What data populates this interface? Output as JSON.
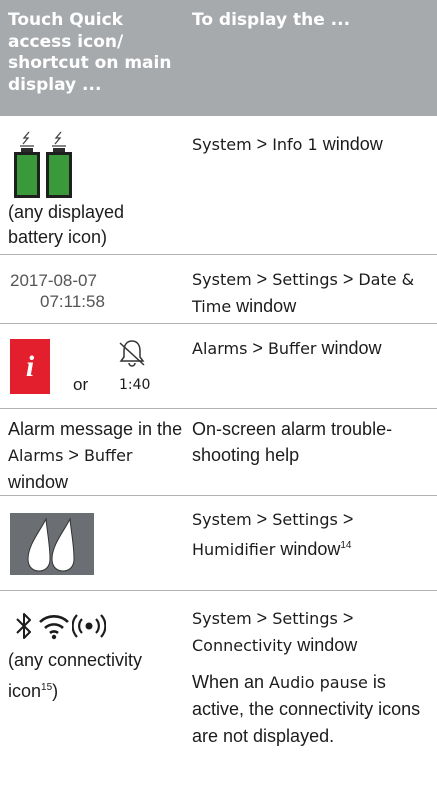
{
  "header": {
    "col1": "Touch Quick access icon/ shortcut on main display ...",
    "col2": "To display the ..."
  },
  "rows": [
    {
      "left_caption": "(any displayed battery icon)",
      "right": {
        "p1": "System",
        "sep1": " > ",
        "p2": "Info 1",
        "p3": " window"
      }
    },
    {
      "date": "2017-08-07",
      "time": "07:11:58",
      "right": {
        "p1": "System",
        "sep1": " > ",
        "p2": "Settings",
        "sep2": " > ",
        "p3": "Date & Time",
        "p4": " window"
      }
    },
    {
      "or": "or",
      "timer": "1:40",
      "right": {
        "p1": "Alarms",
        "sep1": " > ",
        "p2": "Buffer",
        "p3": " window"
      }
    },
    {
      "left": {
        "t1": "Alarm message in the ",
        "t2": "Alarms",
        "t3": " > ",
        "t4": "Buffer",
        "t5": " window"
      },
      "right": "On-screen alarm trouble-shooting help"
    },
    {
      "right": {
        "p1": "System",
        "sep1": " > ",
        "p2": "Settings",
        "sep2": " > ",
        "p3": "Humidifier",
        "p4": " window",
        "sup": "14"
      }
    },
    {
      "left_caption": "(any connectivity icon",
      "left_sup": "15",
      "left_close": ")",
      "right": {
        "p1": "System",
        "sep1": " > ",
        "p2": "Settings",
        "sep2": " > ",
        "p3": "Connectivity",
        "p4": " window"
      },
      "note": {
        "n1": "When an ",
        "n2": "Audio pause",
        "n3": " is active, the connectivity icons are not displayed."
      }
    }
  ],
  "colors": {
    "header_bg": "#a7aaad",
    "alarm_red": "#e31e2d",
    "battery_green": "#3a9a3a",
    "humidifier_bg": "#6b6e72"
  },
  "icons": [
    "battery-icon",
    "info-alarm-icon",
    "bell-muted-icon",
    "humidifier-icon",
    "bluetooth-icon",
    "wifi-icon",
    "broadcast-icon"
  ]
}
